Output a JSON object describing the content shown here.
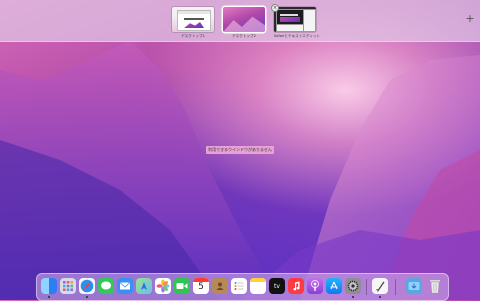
{
  "spaces": [
    {
      "name": "デスクトップ1"
    },
    {
      "name": "デスクトップ2"
    },
    {
      "name": "Safariとテキストエディット"
    }
  ],
  "add_space_symbol": "+",
  "close_symbol": "×",
  "notice": "利用できるウインドウがありません",
  "calendar_day": "5",
  "appletv_text": "tv",
  "dock": {
    "apps": [
      {
        "icon": "finder-icon"
      },
      {
        "icon": "launchpad-icon"
      },
      {
        "icon": "safari-icon"
      },
      {
        "icon": "messages-icon"
      },
      {
        "icon": "mail-icon"
      },
      {
        "icon": "maps-icon"
      },
      {
        "icon": "photos-icon"
      },
      {
        "icon": "facetime-icon"
      },
      {
        "icon": "calendar-icon"
      },
      {
        "icon": "contacts-icon"
      },
      {
        "icon": "reminders-icon"
      },
      {
        "icon": "notes-icon"
      },
      {
        "icon": "appletv-icon"
      },
      {
        "icon": "music-icon"
      },
      {
        "icon": "podcasts-icon"
      },
      {
        "icon": "appstore-icon"
      },
      {
        "icon": "system-preferences-icon"
      },
      {
        "icon": "textedit-icon"
      },
      {
        "icon": "downloads-folder-icon"
      },
      {
        "icon": "trash-icon"
      }
    ]
  }
}
